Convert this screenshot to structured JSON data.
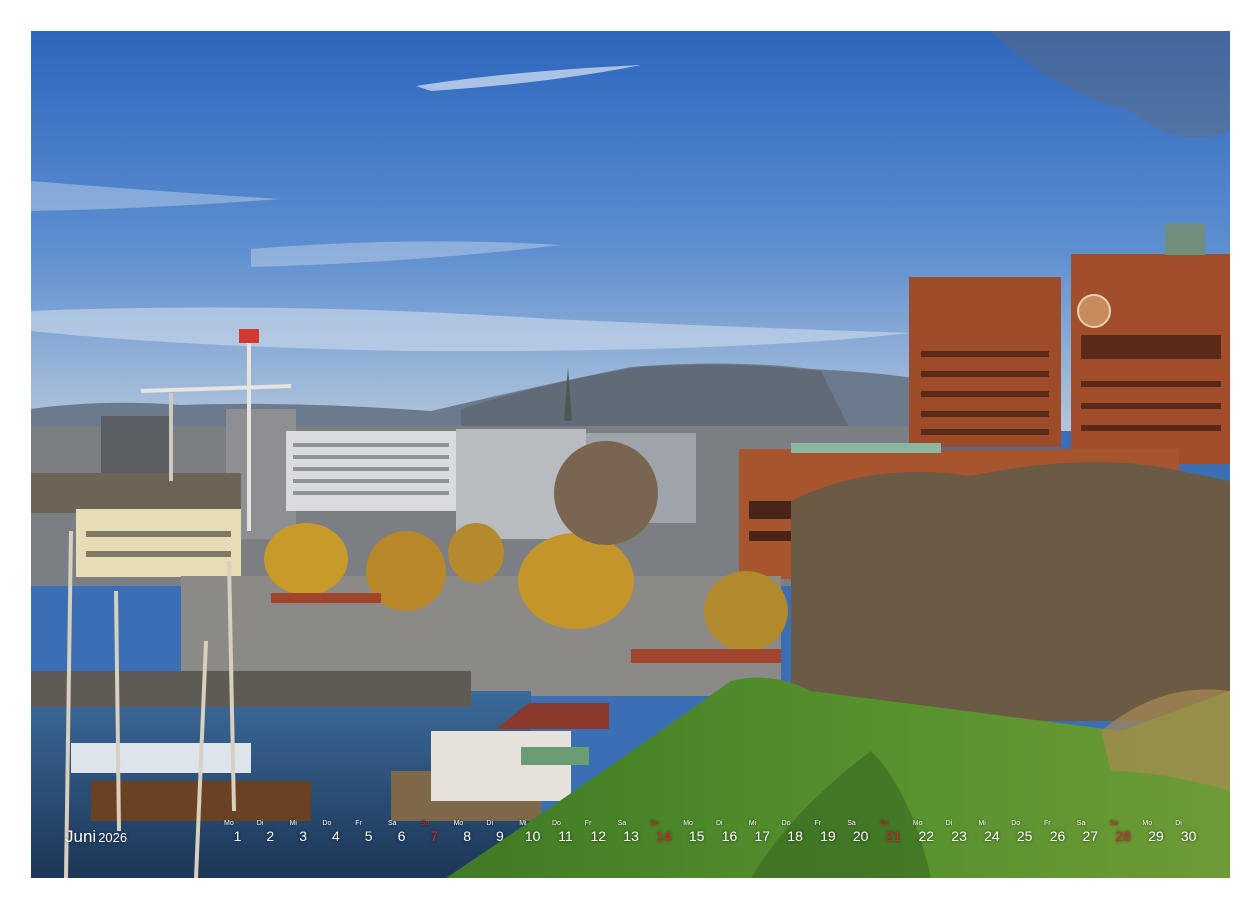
{
  "calendar": {
    "month": "Juni",
    "year": "2026",
    "days": [
      {
        "wd": "Mo",
        "d": "1",
        "sun": false
      },
      {
        "wd": "Di",
        "d": "2",
        "sun": false
      },
      {
        "wd": "Mi",
        "d": "3",
        "sun": false
      },
      {
        "wd": "Do",
        "d": "4",
        "sun": false
      },
      {
        "wd": "Fr",
        "d": "5",
        "sun": false
      },
      {
        "wd": "Sa",
        "d": "6",
        "sun": false
      },
      {
        "wd": "So",
        "d": "7",
        "sun": true
      },
      {
        "wd": "Mo",
        "d": "8",
        "sun": false
      },
      {
        "wd": "Di",
        "d": "9",
        "sun": false
      },
      {
        "wd": "Mi",
        "d": "10",
        "sun": false
      },
      {
        "wd": "Do",
        "d": "11",
        "sun": false
      },
      {
        "wd": "Fr",
        "d": "12",
        "sun": false
      },
      {
        "wd": "Sa",
        "d": "13",
        "sun": false
      },
      {
        "wd": "So",
        "d": "14",
        "sun": true
      },
      {
        "wd": "Mo",
        "d": "15",
        "sun": false
      },
      {
        "wd": "Di",
        "d": "16",
        "sun": false
      },
      {
        "wd": "Mi",
        "d": "17",
        "sun": false
      },
      {
        "wd": "Do",
        "d": "18",
        "sun": false
      },
      {
        "wd": "Fr",
        "d": "19",
        "sun": false
      },
      {
        "wd": "Sa",
        "d": "20",
        "sun": false
      },
      {
        "wd": "So",
        "d": "21",
        "sun": true
      },
      {
        "wd": "Mo",
        "d": "22",
        "sun": false
      },
      {
        "wd": "Di",
        "d": "23",
        "sun": false
      },
      {
        "wd": "Mi",
        "d": "24",
        "sun": false
      },
      {
        "wd": "Do",
        "d": "25",
        "sun": false
      },
      {
        "wd": "Fr",
        "d": "26",
        "sun": false
      },
      {
        "wd": "Sa",
        "d": "27",
        "sun": false
      },
      {
        "wd": "So",
        "d": "28",
        "sun": true
      },
      {
        "wd": "Mo",
        "d": "29",
        "sun": false
      },
      {
        "wd": "Di",
        "d": "30",
        "sun": false
      }
    ]
  },
  "clock_face": "clock-icon",
  "colors": {
    "sky_top": "#2f6bc0",
    "sky_bottom": "#9fb9d8",
    "brick": "#9a4a2a",
    "grass": "#4d8a2a",
    "sunday_red": "#e0202a"
  }
}
